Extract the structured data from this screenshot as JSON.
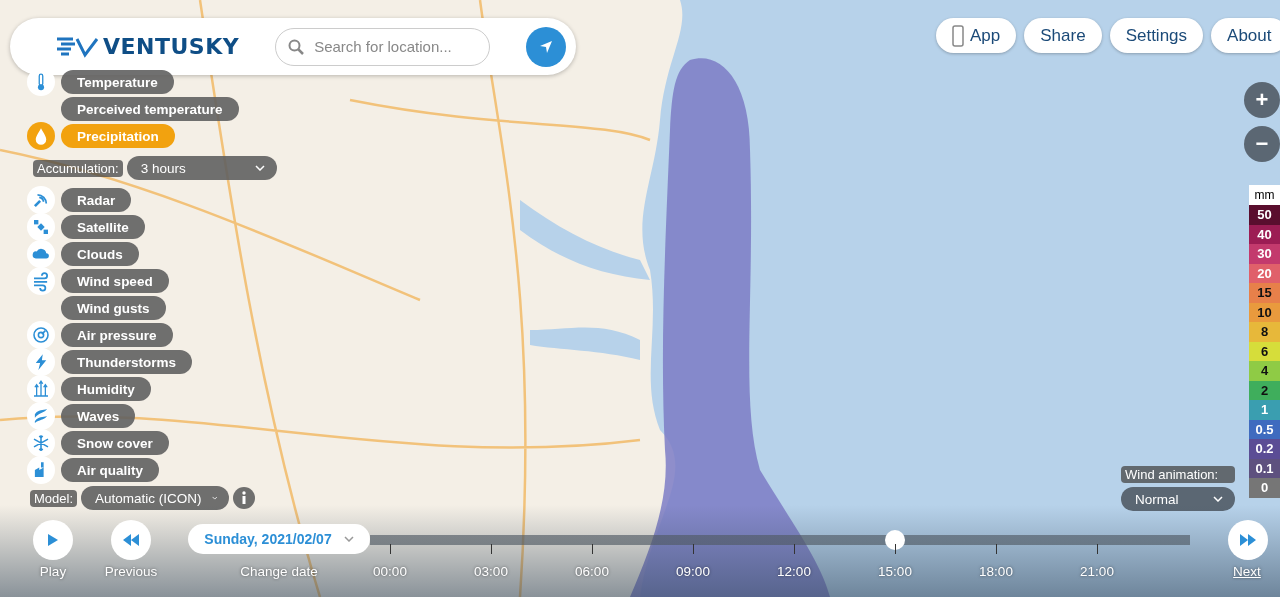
{
  "header": {
    "logo": "VENTUSKY",
    "search": {
      "placeholder": "Search for location..."
    }
  },
  "top_buttons": [
    {
      "label": "App",
      "kind": "app"
    },
    {
      "label": "Share",
      "kind": "plain"
    },
    {
      "label": "Settings",
      "kind": "plain"
    },
    {
      "label": "About",
      "kind": "plain"
    }
  ],
  "layers": [
    {
      "label": "Temperature",
      "selected": false
    },
    {
      "label": "Perceived temperature",
      "selected": false
    },
    {
      "label": "Precipitation",
      "selected": true
    },
    {
      "label": "Radar",
      "selected": false
    },
    {
      "label": "Satellite",
      "selected": false
    },
    {
      "label": "Clouds",
      "selected": false
    },
    {
      "label": "Wind speed",
      "selected": false
    },
    {
      "label": "Wind gusts",
      "selected": false
    },
    {
      "label": "Air pressure",
      "selected": false
    },
    {
      "label": "Thunderstorms",
      "selected": false
    },
    {
      "label": "Humidity",
      "selected": false
    },
    {
      "label": "Waves",
      "selected": false
    },
    {
      "label": "Snow cover",
      "selected": false
    },
    {
      "label": "Air quality",
      "selected": false
    }
  ],
  "accumulation": {
    "label": "Accumulation:",
    "value": "3 hours"
  },
  "model": {
    "label": "Model:",
    "value": "Automatic (ICON)"
  },
  "zoom": {
    "in": "+",
    "out": "−"
  },
  "legend": {
    "unit": "mm",
    "items": [
      {
        "label": "50",
        "color": "#5a0e2e"
      },
      {
        "label": "40",
        "color": "#9c1d54"
      },
      {
        "label": "30",
        "color": "#c33a6d"
      },
      {
        "label": "20",
        "color": "#e0606a"
      },
      {
        "label": "15",
        "color": "#e7804a"
      },
      {
        "label": "10",
        "color": "#e99a3d"
      },
      {
        "label": "8",
        "color": "#e7b83a"
      },
      {
        "label": "6",
        "color": "#d6dd3a"
      },
      {
        "label": "4",
        "color": "#8fcb45"
      },
      {
        "label": "2",
        "color": "#3fae5c"
      },
      {
        "label": "1",
        "color": "#3a9eb0"
      },
      {
        "label": "0.5",
        "color": "#3f6bbf"
      },
      {
        "label": "0.2",
        "color": "#5b4d95"
      },
      {
        "label": "0.1",
        "color": "#5e517f"
      },
      {
        "label": "0",
        "color": "#767676"
      }
    ]
  },
  "wind_animation": {
    "label": "Wind animation:",
    "value": "Normal"
  },
  "controls": {
    "play": "Play",
    "previous": "Previous",
    "change_date": "Change date",
    "date": "Sunday, 2021/02/07",
    "next": "Next"
  },
  "timeline": {
    "level": 0.636,
    "ticks": [
      "00:00",
      "03:00",
      "06:00",
      "09:00",
      "12:00",
      "15:00",
      "18:00",
      "21:00"
    ]
  }
}
